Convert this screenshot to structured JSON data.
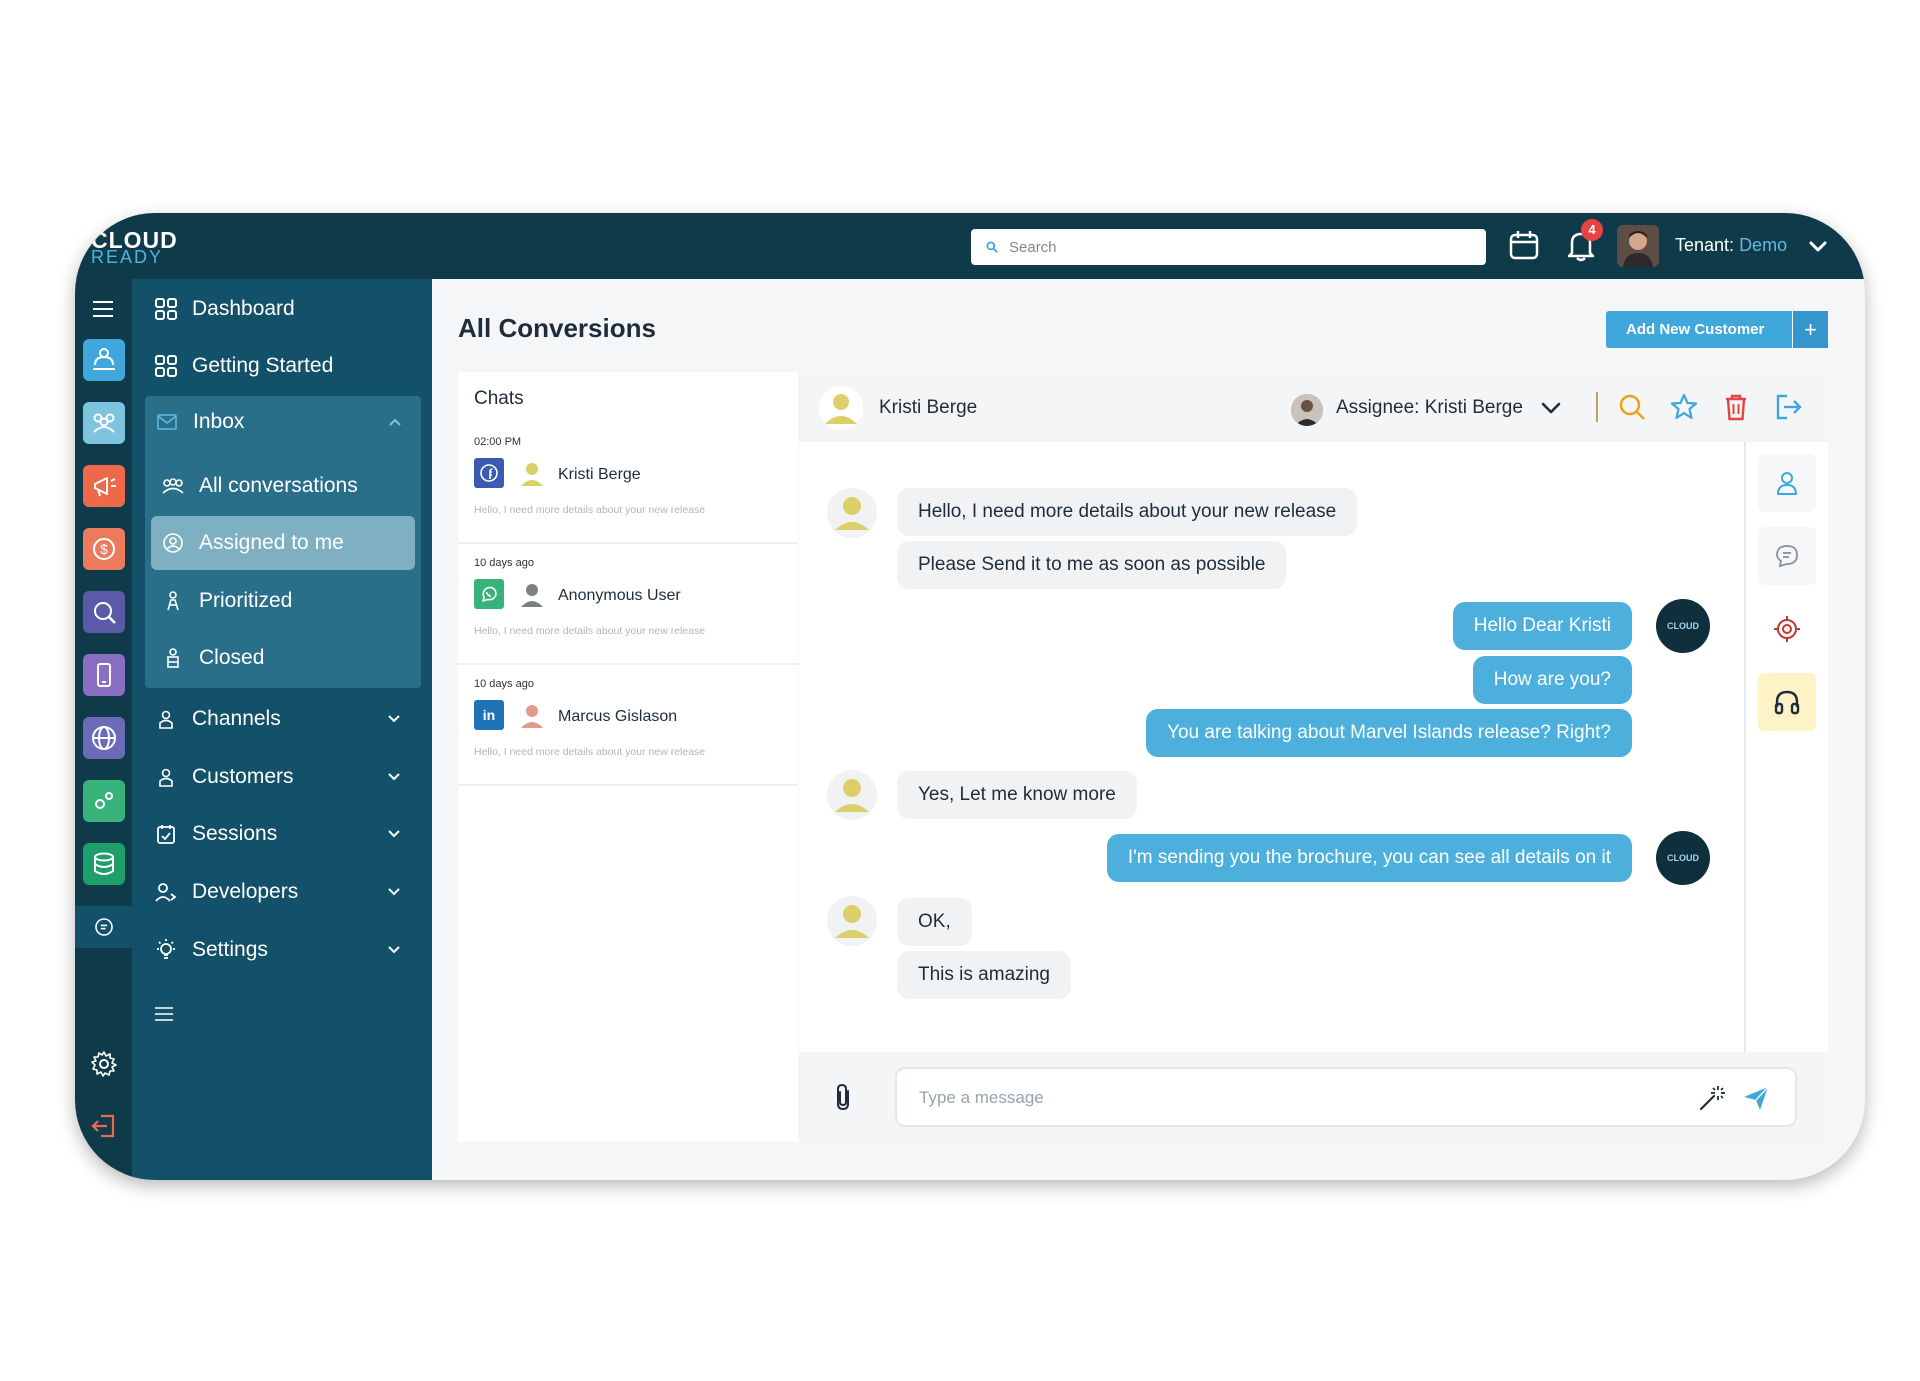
{
  "app": {
    "logo_top": "CLOUD",
    "logo_bottom": "READY"
  },
  "topbar": {
    "search_placeholder": "Search",
    "notification_count": "4",
    "tenant_label": "Tenant:",
    "tenant_value": "Demo"
  },
  "sidebar": {
    "dashboard": "Dashboard",
    "getting_started": "Getting Started",
    "inbox": "Inbox",
    "inbox_items": [
      "All conversations",
      "Assigned to me",
      "Prioritized",
      "Closed"
    ],
    "channels": "Channels",
    "customers": "Customers",
    "sessions": "Sessions",
    "developers": "Developers",
    "settings": "Settings"
  },
  "main": {
    "title": "All Conversions",
    "add_button": "Add New Customer",
    "add_plus": "+"
  },
  "chats": {
    "label": "Chats",
    "items": [
      {
        "time": "02:00 PM",
        "channel": "facebook",
        "name": "Kristi Berge",
        "preview": "Hello, I need more details about your new release"
      },
      {
        "time": "10 days ago",
        "channel": "whatsapp",
        "name": "Anonymous User",
        "preview": "Hello, I need more details about your new release"
      },
      {
        "time": "10 days ago",
        "channel": "linkedin",
        "name": "Marcus Gislason",
        "preview": "Hello, I need more details about your new release"
      }
    ],
    "linkedin_glyph": "in"
  },
  "conversation": {
    "contact_name": "Kristi Berge",
    "assignee": "Assignee: Kristi Berge",
    "bot_avatar_text": "CLOUD",
    "messages": [
      {
        "from": "customer",
        "text": "Hello, I need more details about your new release"
      },
      {
        "from": "customer",
        "text": "Please Send it to me as soon as possible"
      },
      {
        "from": "agent",
        "text": "Hello Dear Kristi"
      },
      {
        "from": "agent",
        "text": "How are you?"
      },
      {
        "from": "agent",
        "text": "You are talking about Marvel Islands release? Right?"
      },
      {
        "from": "customer",
        "text": "Yes, Let me know more"
      },
      {
        "from": "agent",
        "text": "I'm sending you the brochure, you can see all details on it"
      },
      {
        "from": "customer",
        "text": "OK,"
      },
      {
        "from": "customer",
        "text": "This is amazing"
      }
    ],
    "composer_placeholder": "Type a message"
  },
  "colors": {
    "topbar": "#0f3a4a",
    "sidebar": "#13506a",
    "accent": "#4db0dc",
    "active_nav": "#7eb0c2"
  }
}
